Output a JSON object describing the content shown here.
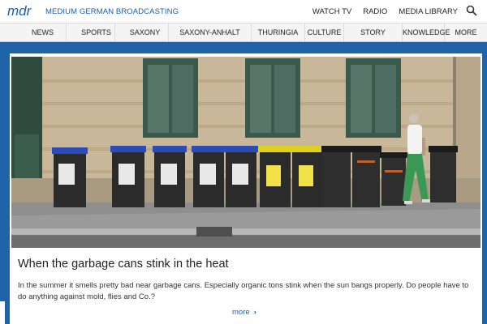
{
  "header": {
    "brand": "MEDIUM GERMAN BROADCASTING",
    "links": [
      "WATCH TV",
      "RADIO",
      "MEDIA LIBRARY"
    ]
  },
  "nav": {
    "items": [
      "NEWS",
      "SPORTS",
      "SAXONY",
      "SAXONY-ANHALT",
      "THURINGIA",
      "CULTURE",
      "STORY",
      "KNOWLEDGE",
      "MORE"
    ]
  },
  "article": {
    "headline": "When the garbage cans stink in the heat",
    "teaser": "In the summer it smells pretty bad near garbage cans. Especially organic tons stink when the sun bangs properly. Do people have to do anything against mold, flies and Co.?",
    "more_label": "more"
  },
  "colors": {
    "brand_blue": "#1b5ea6",
    "background_blue": "#1f63a8"
  },
  "icons": [
    "mdr-logo",
    "search-icon",
    "chevron-right-icon"
  ]
}
